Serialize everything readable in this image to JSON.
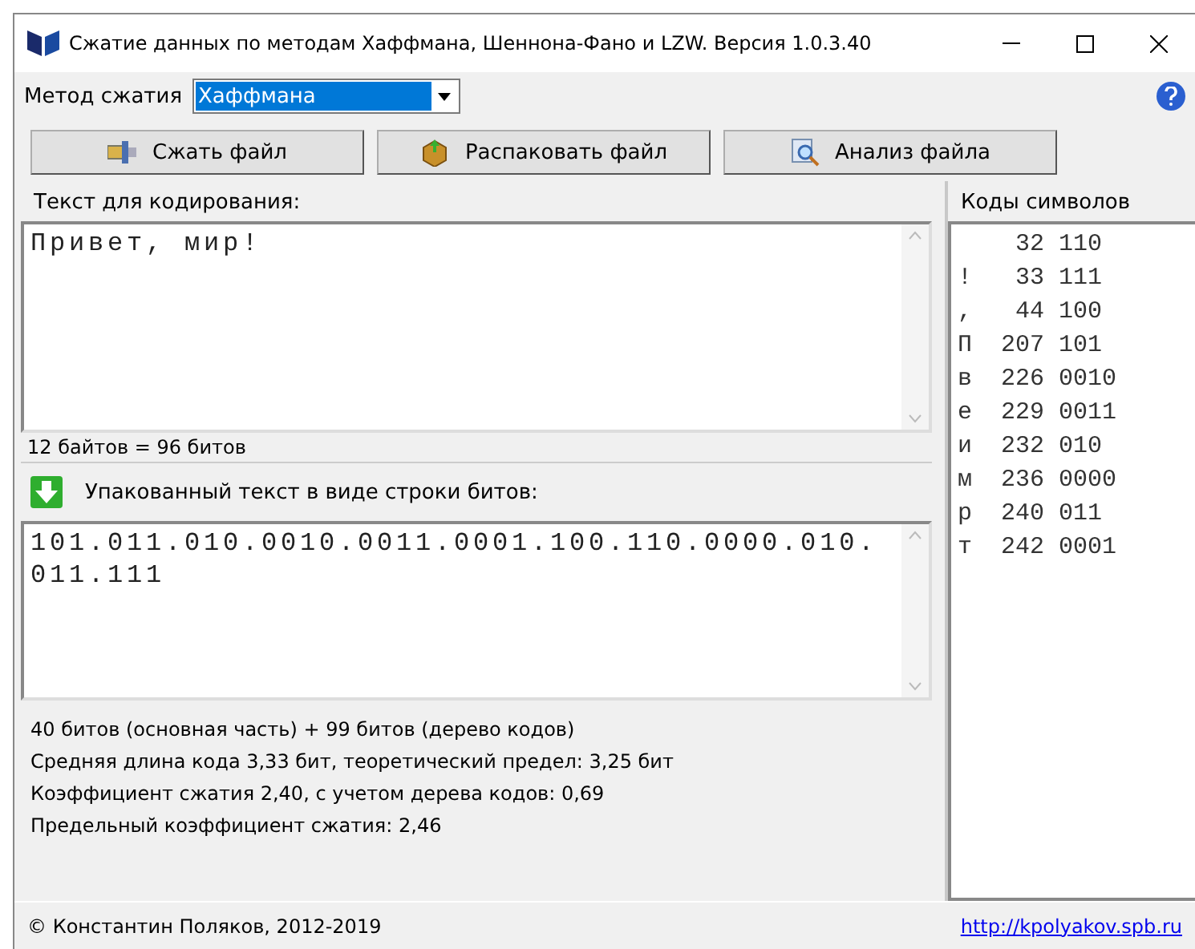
{
  "window": {
    "title": "Сжатие данных по методам Хаффмана, Шеннона-Фано и LZW. Версия 1.0.3.40"
  },
  "method": {
    "label": "Метод сжатия",
    "value": "Хаффмана"
  },
  "buttons": [
    {
      "kind": "compress",
      "label": "Сжать файл"
    },
    {
      "kind": "unpack",
      "label": "Распаковать файл"
    },
    {
      "kind": "analyze",
      "label": "Анализ файла"
    }
  ],
  "source": {
    "label": "Текст для кодирования:",
    "value": "Привет, мир!",
    "size": "12 байтов = 96 битов"
  },
  "packed": {
    "label": "Упакованный текст в виде строки битов:",
    "value": "101.011.010.0010.0011.0001.100.110.0000.010.011.111"
  },
  "stats": [
    "40 битов (основная часть) + 99 битов (дерево кодов)",
    "Средняя длина кода 3,33 бит, теоретический предел: 3,25 бит",
    "Коэффициент сжатия 2,40, с учетом дерева кодов: 0,69",
    "Предельный коэффициент сжатия: 2,46"
  ],
  "codes": {
    "label": "Коды символов",
    "rows": [
      {
        "number": "32",
        "bits": "110"
      },
      {
        "char": "!",
        "number": "33",
        "bits": "111"
      },
      {
        "char": ",",
        "number": "44",
        "bits": "100"
      },
      {
        "char": "П",
        "number": "207",
        "bits": "101"
      },
      {
        "char": "в",
        "number": "226",
        "bits": "0010"
      },
      {
        "char": "е",
        "number": "229",
        "bits": "0011"
      },
      {
        "char": "и",
        "number": "232",
        "bits": "010"
      },
      {
        "char": "м",
        "number": "236",
        "bits": "0000"
      },
      {
        "char": "р",
        "number": "240",
        "bits": "011"
      },
      {
        "char": "т",
        "number": "242",
        "bits": "0001"
      }
    ]
  },
  "footer": {
    "copyright": "© Константин Поляков, 2012-2019",
    "link": "http://kpolyakov.spb.ru"
  }
}
